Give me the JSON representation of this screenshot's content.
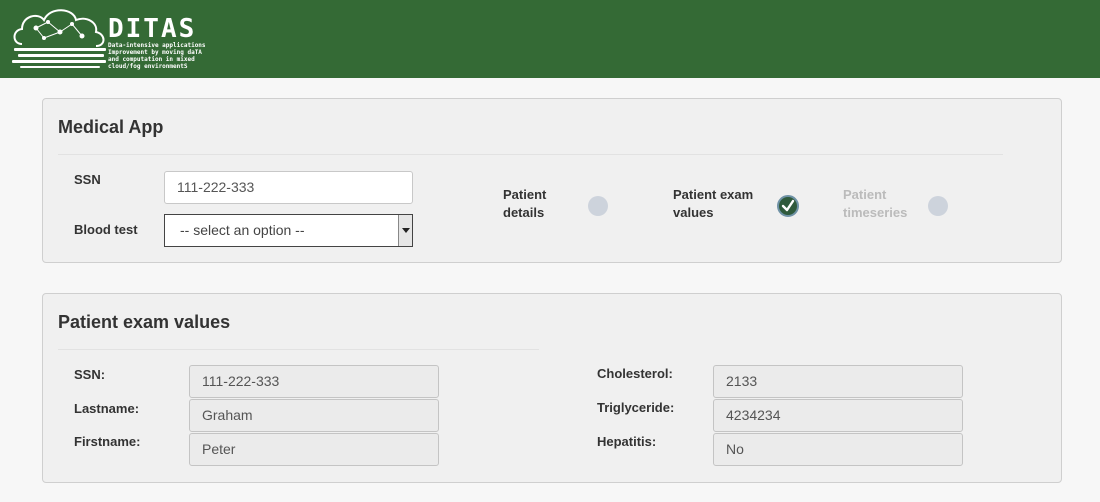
{
  "header": {
    "brand": "DITAS",
    "tagline": "Data-intensive applications Improvement by moving daTA and computation in mixed cloud/fog environmentS"
  },
  "app_panel": {
    "title": "Medical App",
    "ssn_label": "SSN",
    "ssn_value": "111-222-333",
    "blood_test_label": "Blood test",
    "blood_test_selected": "-- select an option --",
    "steps": [
      {
        "line1": "Patient",
        "line2": "details",
        "state": "pending"
      },
      {
        "line1": "Patient exam",
        "line2": "values",
        "state": "done"
      },
      {
        "line1": "Patient",
        "line2": "timeseries",
        "state": "disabled"
      }
    ]
  },
  "exam_panel": {
    "title": "Patient exam values",
    "left_fields": [
      {
        "label": "SSN:",
        "value": "111-222-333"
      },
      {
        "label": "Lastname:",
        "value": "Graham"
      },
      {
        "label": "Firstname:",
        "value": "Peter"
      }
    ],
    "right_fields": [
      {
        "label": "Cholesterol:",
        "value": "2133"
      },
      {
        "label": "Triglyceride:",
        "value": "4234234"
      },
      {
        "label": "Hepatitis:",
        "value": "No"
      }
    ]
  },
  "colors": {
    "header_bg": "#346a35",
    "panel_bg": "#f0f0f0",
    "check_bg": "#2f5a3c"
  }
}
